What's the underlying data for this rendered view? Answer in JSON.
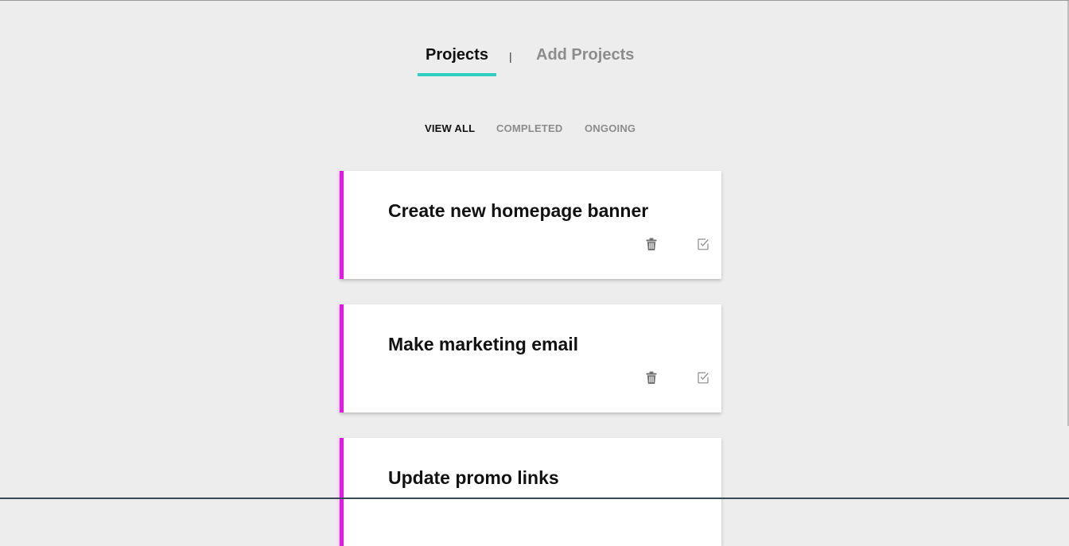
{
  "tabs": {
    "projects_label": "Projects",
    "divider": "|",
    "add_projects_label": "Add Projects",
    "active": "Projects"
  },
  "filters": {
    "view_all": "VIEW ALL",
    "completed": "COMPLETED",
    "ongoing": "ONGOING",
    "active": "VIEW ALL"
  },
  "projects": [
    {
      "title": "Create new homepage banner",
      "delete_icon": "trash-icon",
      "complete_icon": "checkbox-check-icon"
    },
    {
      "title": "Make marketing email",
      "delete_icon": "trash-icon",
      "complete_icon": "checkbox-check-icon"
    },
    {
      "title": "Update promo links",
      "delete_icon": "trash-icon",
      "complete_icon": "checkbox-check-icon"
    }
  ],
  "colors": {
    "background": "#ededed",
    "accent_underline": "#2fd0c4",
    "card_border": "#ee10ee",
    "active_text": "#111111",
    "inactive_text": "#8c8c8c"
  }
}
